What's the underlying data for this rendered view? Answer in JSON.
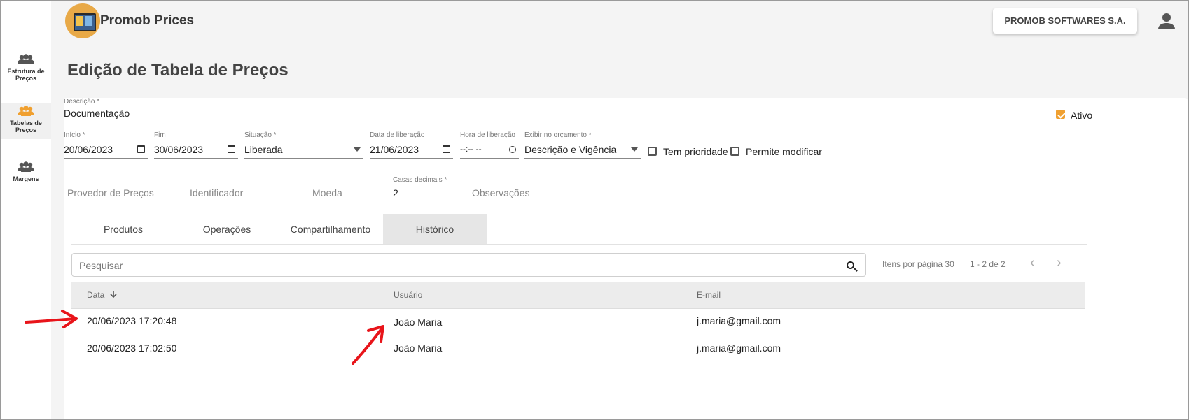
{
  "app": {
    "title": "Promob Prices",
    "company": "PROMOB SOFTWARES S.A."
  },
  "sidebar": {
    "items": [
      {
        "label_line1": "Estrutura de",
        "label_line2": "Preços"
      },
      {
        "label_line1": "Tabelas de",
        "label_line2": "Preços"
      },
      {
        "label_line1": "Margens",
        "label_line2": ""
      }
    ]
  },
  "page": {
    "title": "Edição de Tabela de Preços"
  },
  "form": {
    "descricao": {
      "label": "Descrição *",
      "value": "Documentação"
    },
    "ativo": {
      "label": "Ativo",
      "checked": true
    },
    "inicio": {
      "label": "Início *",
      "value": "20/06/2023"
    },
    "fim": {
      "label": "Fim",
      "value": "30/06/2023"
    },
    "situacao": {
      "label": "Situação *",
      "value": "Liberada"
    },
    "data_liberacao": {
      "label": "Data de liberação",
      "value": "21/06/2023"
    },
    "hora_liberacao": {
      "label": "Hora de liberação",
      "value": "--:-- --"
    },
    "exibir": {
      "label": "Exibir no orçamento *",
      "value": "Descrição e Vigência"
    },
    "tem_prioridade": {
      "label": "Tem prioridade",
      "checked": false
    },
    "permite_modificar": {
      "label": "Permite modificar",
      "checked": false
    },
    "provedor": {
      "placeholder": "Provedor de Preços"
    },
    "identificador": {
      "placeholder": "Identificador"
    },
    "moeda": {
      "placeholder": "Moeda"
    },
    "casas": {
      "label": "Casas decimais *",
      "value": "2"
    },
    "observacoes": {
      "placeholder": "Observações"
    }
  },
  "tabs": [
    {
      "label": "Produtos"
    },
    {
      "label": "Operações"
    },
    {
      "label": "Compartilhamento"
    },
    {
      "label": "Histórico",
      "active": true
    }
  ],
  "search": {
    "placeholder": "Pesquisar"
  },
  "pagination": {
    "items_per_page": "Itens por página 30",
    "range": "1 - 2 de 2"
  },
  "table": {
    "headers": [
      "Data",
      "Usuário",
      "E-mail"
    ],
    "sort_icon": "arrow-down-icon",
    "rows": [
      [
        "20/06/2023 17:20:48",
        "João Maria",
        "j.maria@gmail.com"
      ],
      [
        "20/06/2023 17:02:50",
        "João Maria",
        "j.maria@gmail.com"
      ]
    ]
  },
  "colors": {
    "accent": "#f0a030",
    "annotation": "#e8141a"
  }
}
